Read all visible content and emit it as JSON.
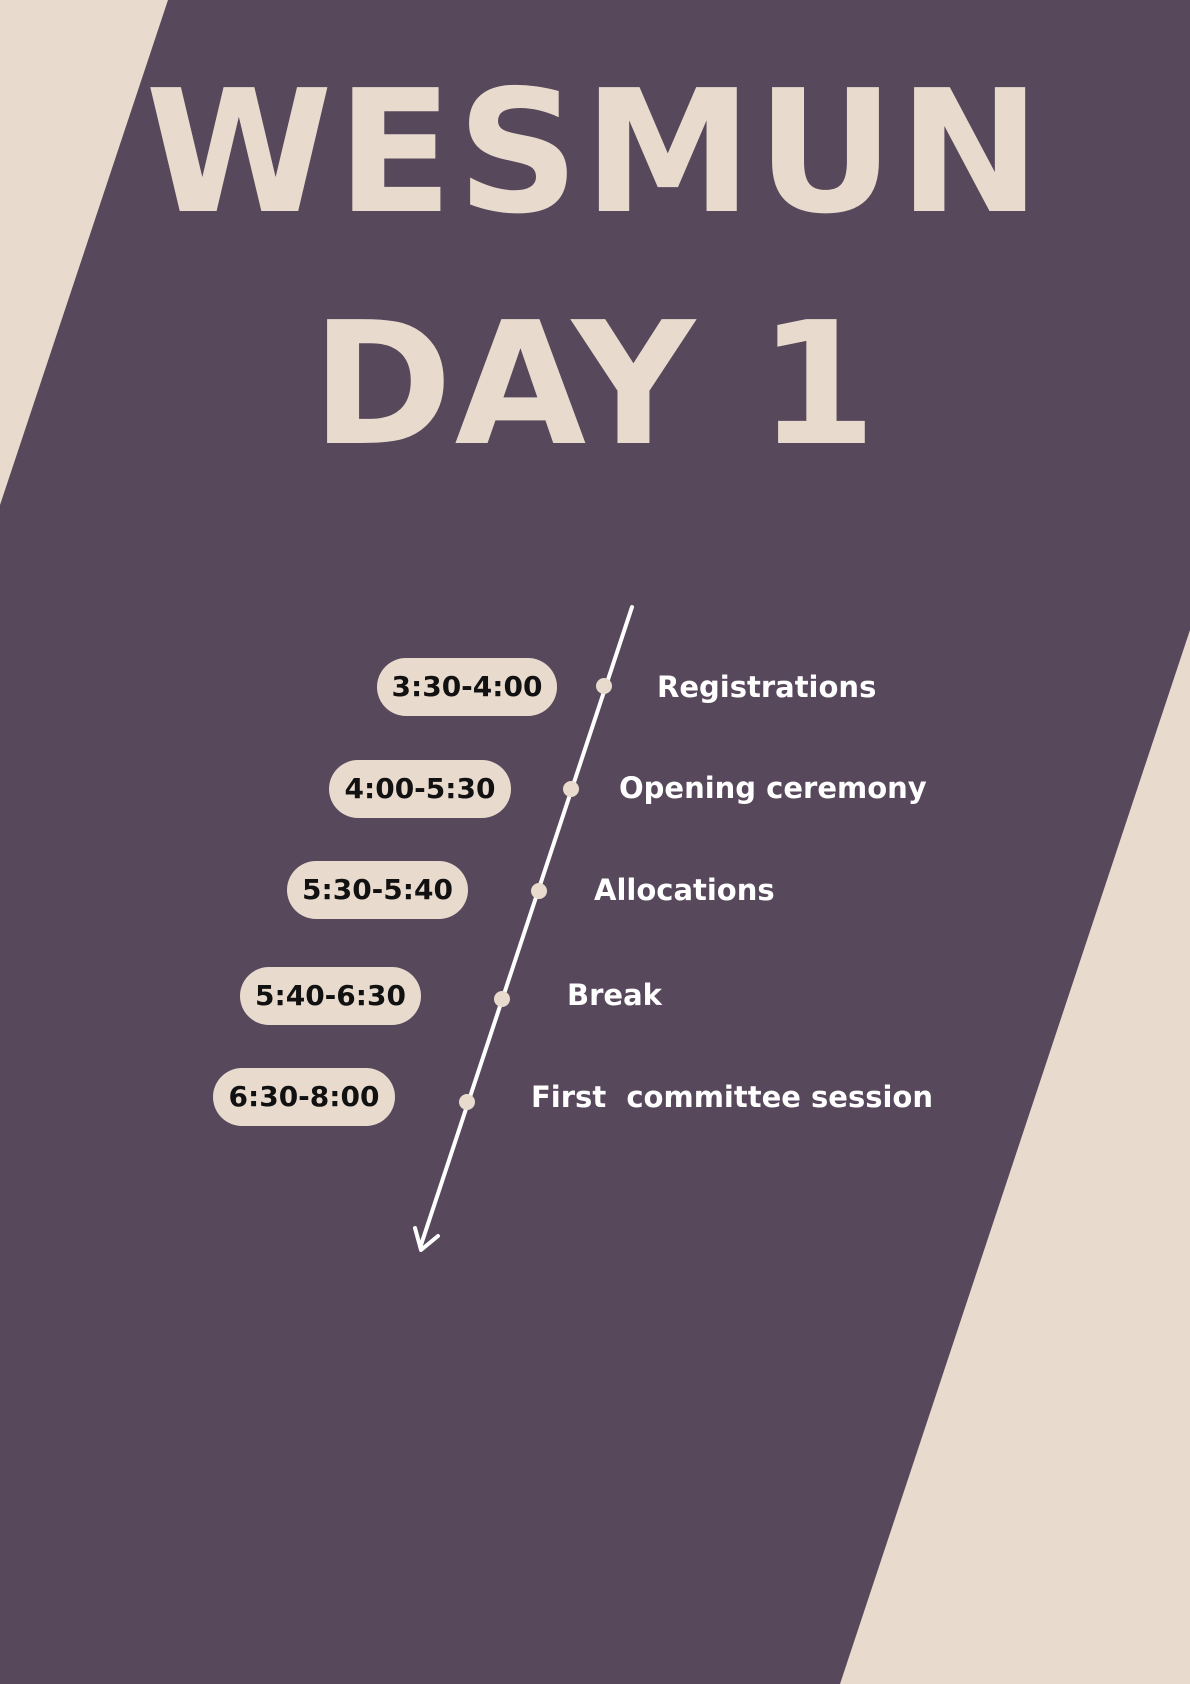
{
  "colors": {
    "background": "#e8dbce",
    "panel": "#58485c",
    "accent": "#e8dbce",
    "text_light": "#ffffff",
    "text_dark": "#111111"
  },
  "header": {
    "line1": "WESMUN",
    "line2": "DAY 1"
  },
  "timeline": {
    "items": [
      {
        "time": "3:30-4:00",
        "event": "Registrations"
      },
      {
        "time": "4:00-5:30",
        "event": "Opening ceremony"
      },
      {
        "time": "5:30-5:40",
        "event": "Allocations"
      },
      {
        "time": "5:40-6:30",
        "event": "Break"
      },
      {
        "time": "6:30-8:00",
        "event": "First  committee session"
      }
    ],
    "arrow_icon": "arrow-down-icon"
  }
}
